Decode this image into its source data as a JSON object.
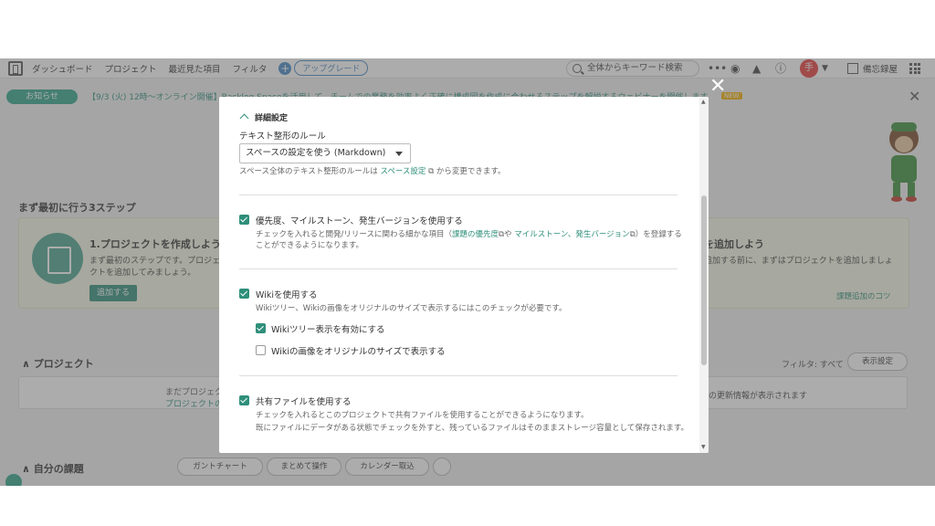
{
  "header": {
    "nav": [
      "ダッシュボード",
      "プロジェクト",
      "最近見た項目",
      "フィルタ"
    ],
    "upgrade_label": "アップグレード",
    "search_placeholder": "全体からキーワード検索",
    "avatar_initial": "手",
    "space_name": "備忘録屋",
    "avatar_color": "#e83a3a"
  },
  "notice": {
    "badge": "お知らせ",
    "text": "【9/3 (火) 12時～オンライン開催】Backlog Spaceを活用して、チームでの業務を効率よく正確に構成図を作成に合わせるステップを解説するウェビナーを開催します",
    "new_label": "NEW"
  },
  "steps": {
    "title": "まず最初に行う3ステップ",
    "step1_title": "1.プロジェクトを作成しよう",
    "step1_desc": "まず最初のステップです。プロジェクトを追加してみましょう。",
    "step1_button": "追加する",
    "step3_title": "を追加しよう",
    "step3_desc": "追加する前に、まずはプロジェクトを追加しましょ",
    "step3_link": "課題追加のコツ"
  },
  "projects": {
    "title": "プロジェクト",
    "filter_label": "フィルタ: すべて",
    "view_button": "表示設定",
    "empty_line1": "まだプロジェク",
    "empty_line2": "プロジェクトの",
    "updates_text": "の更新情報が表示されます"
  },
  "my_issues": {
    "title": "自分の課題",
    "buttons": [
      "ガントチャート",
      "まとめて操作",
      "カレンダー取込"
    ]
  },
  "modal": {
    "section_title": "詳細設定",
    "text_rule_label": "テキスト整形のルール",
    "text_rule_value": "スペースの設定を使う (Markdown)",
    "text_rule_hint_prefix": "スペース全体のテキスト整形のルールは",
    "text_rule_hint_link": "スペース設定",
    "text_rule_hint_suffix": "から変更できます。",
    "opt_priority_label": "優先度、マイルストーン、発生バージョンを使用する",
    "opt_priority_hint_1a": "チェックを入れると開発/リリースに関わる細かな項目（",
    "opt_priority_hint_link1": "課題の優先度",
    "opt_priority_hint_mid": "や",
    "opt_priority_hint_link2": "マイルストーン、発生バージョン",
    "opt_priority_hint_1b": "）を登録する",
    "opt_priority_hint_2": "ことができるようになります。",
    "opt_wiki_label": "Wikiを使用する",
    "opt_wiki_hint": "Wikiツリー、Wikiの画像をオリジナルのサイズで表示するにはこのチェックが必要です。",
    "opt_wiki_tree_label": "Wikiツリー表示を有効にする",
    "opt_wiki_image_label": "Wikiの画像をオリジナルのサイズで表示する",
    "opt_files_label": "共有ファイルを使用する",
    "opt_files_hint_1": "チェックを入れるとこのプロジェクトで共有ファイルを使用することができるようになります。",
    "opt_files_hint_2": "既にファイルにデータがある状態でチェックを外すと、残っているファイルはそのままストレージ容量として保存されます。",
    "checked": {
      "priority": true,
      "wiki": true,
      "wiki_tree": true,
      "wiki_image": false,
      "files": true
    }
  },
  "colors": {
    "accent": "#2e8f7a",
    "brand_green": "#2ea58b",
    "link_blue": "#4488c5"
  }
}
